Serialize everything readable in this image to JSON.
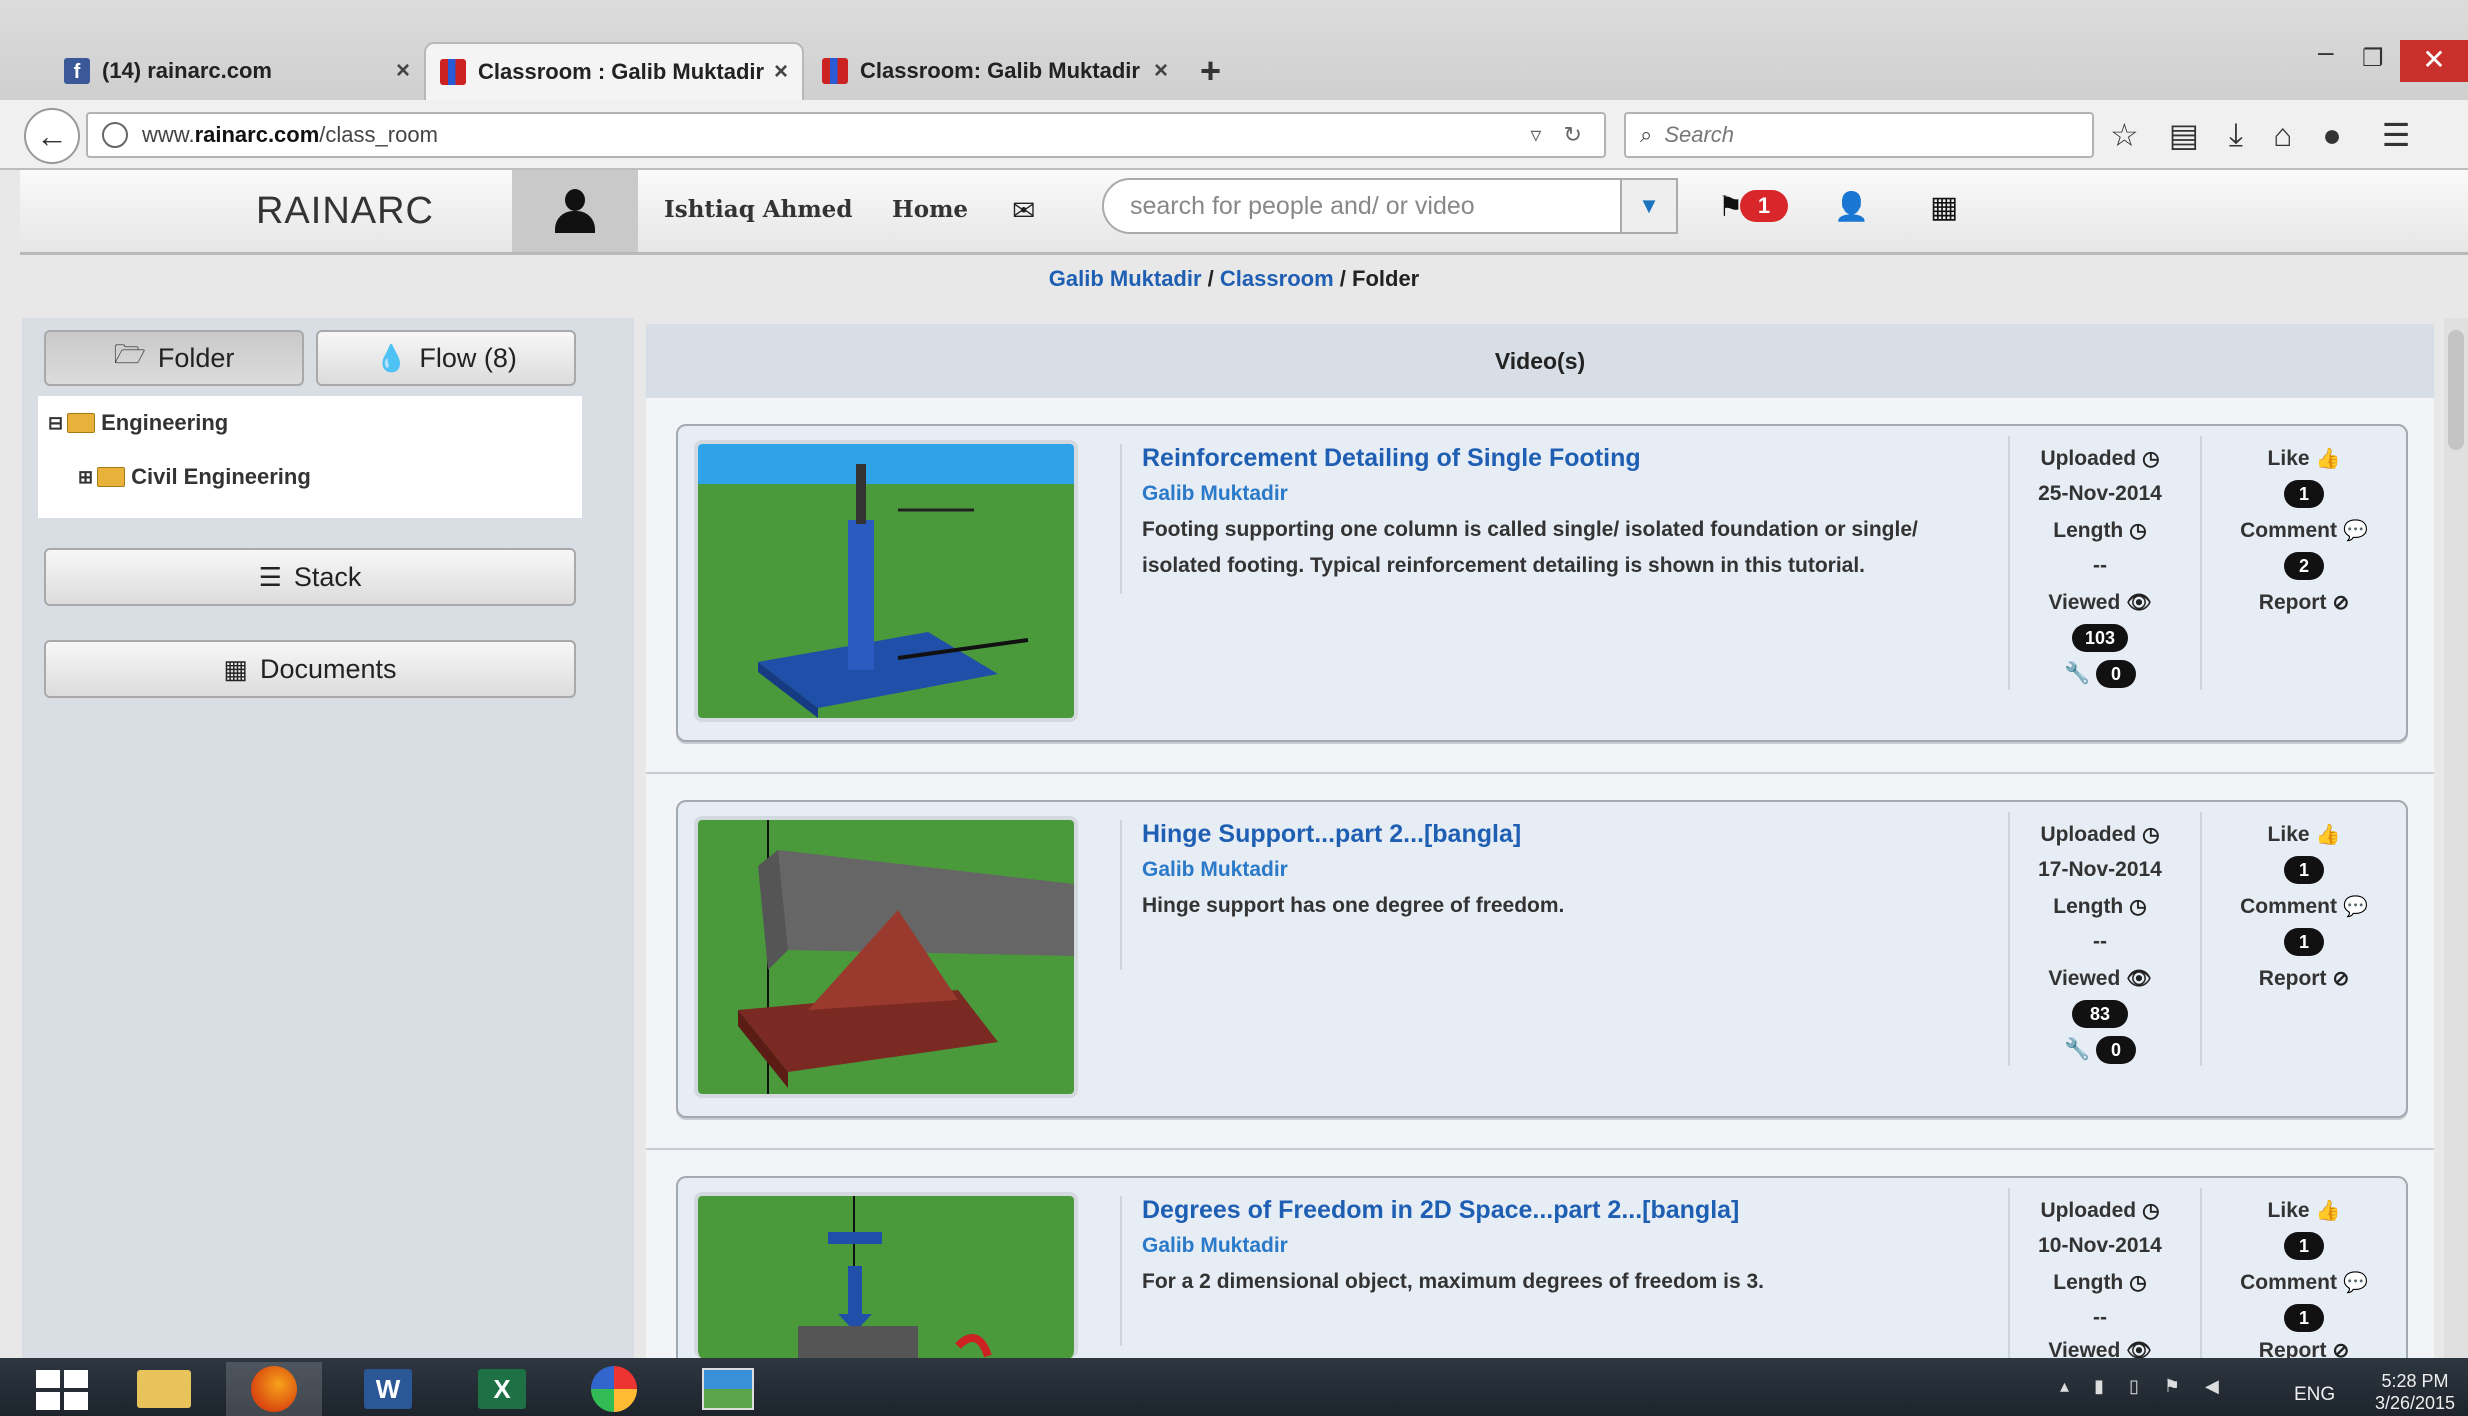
{
  "browser": {
    "tabs": [
      {
        "title": "(14) rainarc.com",
        "active": false
      },
      {
        "title": "Classroom : Galib Muktadir",
        "active": true
      },
      {
        "title": "Classroom: Galib Muktadir",
        "active": false
      }
    ],
    "close_glyph": "×",
    "new_tab": "+",
    "url_prefix": "www.",
    "url_domain": "rainarc.com",
    "url_path": "/class_room",
    "search_placeholder": "Search"
  },
  "site": {
    "brand": "RAINARC",
    "user_name": "Ishtiaq Ahmed",
    "home_label": "Home",
    "search_placeholder": "search for people and/ or video",
    "notification_count": "1"
  },
  "breadcrumb": {
    "owner": "Galib Muktadir",
    "sep1": "/",
    "section": "Classroom",
    "sep2": "/",
    "current": "Folder"
  },
  "sidebar": {
    "folder_label": "Folder",
    "flow_label": "Flow (8)",
    "tree": [
      {
        "label": "Engineering",
        "toggle": "⊟"
      },
      {
        "label": "Civil Engineering",
        "toggle": "⊞"
      }
    ],
    "stack_label": "Stack",
    "documents_label": "Documents"
  },
  "main": {
    "header": "Video(s)",
    "videos": [
      {
        "title": "Reinforcement Detailing of Single Footing",
        "author": "Galib Muktadir",
        "description": "Footing supporting one column is called single/ isolated foundation or single/ isolated footing. Typical reinforcement detailing is shown in this tutorial.",
        "uploaded_label": "Uploaded",
        "uploaded_date": "25-Nov-2014",
        "length_label": "Length",
        "length_value": "--",
        "viewed_label": "Viewed",
        "views": "103",
        "tools_count": "0",
        "like_label": "Like",
        "likes": "1",
        "comment_label": "Comment",
        "comments": "2",
        "report_label": "Report"
      },
      {
        "title": "Hinge Support...part 2...[bangla]",
        "author": "Galib Muktadir",
        "description": "Hinge support has one degree of freedom.",
        "uploaded_label": "Uploaded",
        "uploaded_date": "17-Nov-2014",
        "length_label": "Length",
        "length_value": "--",
        "viewed_label": "Viewed",
        "views": "83",
        "tools_count": "0",
        "like_label": "Like",
        "likes": "1",
        "comment_label": "Comment",
        "comments": "1",
        "report_label": "Report"
      },
      {
        "title": "Degrees of Freedom in 2D Space...part 2...[bangla]",
        "author": "Galib Muktadir",
        "description": "For a 2 dimensional object, maximum degrees of freedom is 3.",
        "uploaded_label": "Uploaded",
        "uploaded_date": "10-Nov-2014",
        "length_label": "Length",
        "length_value": "--",
        "viewed_label": "Viewed",
        "like_label": "Like",
        "likes": "1",
        "comment_label": "Comment",
        "comments": "1",
        "report_label": "Report"
      }
    ]
  },
  "taskbar": {
    "language": "ENG",
    "time": "5:28 PM",
    "date": "3/26/2015"
  },
  "icons": {
    "back": "back-arrow-icon",
    "reload": "reload-icon",
    "bookmark": "star-icon",
    "clock": "clock-icon",
    "eye": "eye-icon",
    "wrench": "wrench-icon",
    "thumbs_up": "thumbs-up-icon",
    "comment": "comment-icon",
    "report": "ban-icon"
  },
  "colors": {
    "link_blue": "#1f5fb3",
    "notification_red": "#d9262b",
    "badge_black": "#111111"
  }
}
